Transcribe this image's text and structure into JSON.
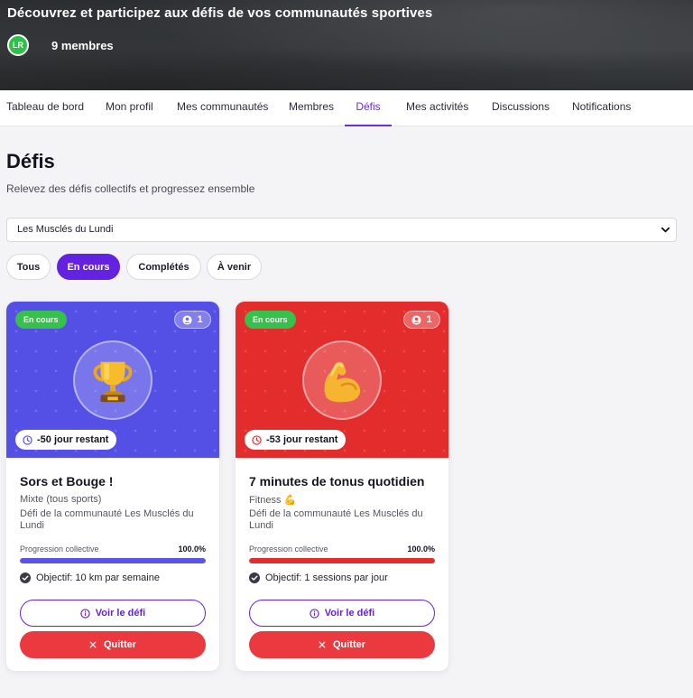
{
  "hero": {
    "subtitle": "Découvrez et participez aux défis de vos communautés sportives",
    "avatar_initials": "LR",
    "members": "9 membres"
  },
  "nav": {
    "items": [
      {
        "label": "Tableau de bord",
        "active": false
      },
      {
        "label": "Mon profil",
        "active": false
      },
      {
        "label": "Mes communautés",
        "active": false
      },
      {
        "label": "Membres",
        "active": false
      },
      {
        "label": "Défis",
        "active": true
      },
      {
        "label": "Mes activités",
        "active": false
      },
      {
        "label": "Discussions",
        "active": false
      },
      {
        "label": "Notifications",
        "active": false
      }
    ]
  },
  "page": {
    "title": "Défis",
    "description": "Relevez des défis collectifs et progressez ensemble"
  },
  "community_select": {
    "value": "Les Musclés du Lundi"
  },
  "filters": [
    {
      "label": "Tous",
      "active": false
    },
    {
      "label": "En cours",
      "active": true
    },
    {
      "label": "Complétés",
      "active": false
    },
    {
      "label": "À venir",
      "active": false
    }
  ],
  "challenges": [
    {
      "status": "En cours",
      "participants": "1",
      "icon": "trophy-icon",
      "banner_color": "#5450e6",
      "days_left": "-50 jour restant",
      "title": "Sors et Bouge !",
      "sport": "Mixte (tous sports)",
      "community": "Défi de la communauté Les Musclés du Lundi",
      "progress_label": "Progression collective",
      "progress_value": "100.0%",
      "progress_fraction": 1.0,
      "progress_color": "#5a55e8",
      "objective": "Objectif: 10 km par semaine",
      "view_label": "Voir le défi",
      "quit_label": "Quitter"
    },
    {
      "status": "En cours",
      "participants": "1",
      "icon": "flexed-biceps-icon",
      "banner_color": "#e32c2c",
      "days_left": "-53 jour restant",
      "title": "7 minutes de tonus quotidien",
      "sport": "Fitness 💪",
      "community": "Défi de la communauté Les Musclés du Lundi",
      "progress_label": "Progression collective",
      "progress_value": "100.0%",
      "progress_fraction": 1.0,
      "progress_color": "#e32c2c",
      "objective": "Objectif: 1 sessions par jour",
      "view_label": "Voir le défi",
      "quit_label": "Quitter"
    }
  ]
}
